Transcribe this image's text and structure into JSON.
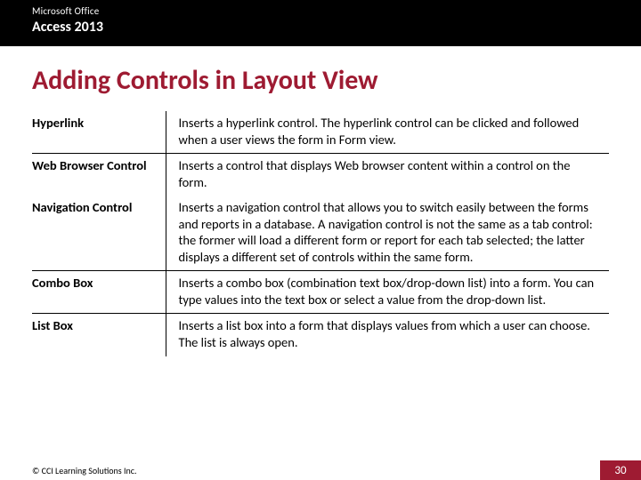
{
  "header": {
    "brand_top": "Microsoft Office",
    "brand_bottom": "Access 2013"
  },
  "title": "Adding Controls in Layout View",
  "rows": [
    {
      "term": "Hyperlink",
      "desc": "Inserts a hyperlink control. The hyperlink control can be clicked and followed when a user views the form in Form view.",
      "hr": false
    },
    {
      "term": "Web Browser Control",
      "desc": "Inserts a control that displays Web browser content within a control on the form.",
      "hr": true
    },
    {
      "term": "Navigation Control",
      "desc": "Inserts a navigation control that allows you to switch easily between the forms and reports in a database. A navigation control is not the same as a tab control: the former will load a different form or report for each tab selected; the latter displays a different set of controls within the same form.",
      "hr": false
    },
    {
      "term": "Combo Box",
      "desc": "Inserts a combo box (combination text box/drop-down list) into a form. You can type values into the text box or select a value from the drop-down list.",
      "hr": true
    },
    {
      "term": "List Box",
      "desc": "Inserts a list box into a form that displays values from which a user can choose. The list is always open.",
      "hr": true
    }
  ],
  "footer": {
    "copyright": "© CCI Learning Solutions Inc.",
    "page_number": "30"
  },
  "colors": {
    "accent": "#9e1b32",
    "header_bg": "#000000"
  }
}
